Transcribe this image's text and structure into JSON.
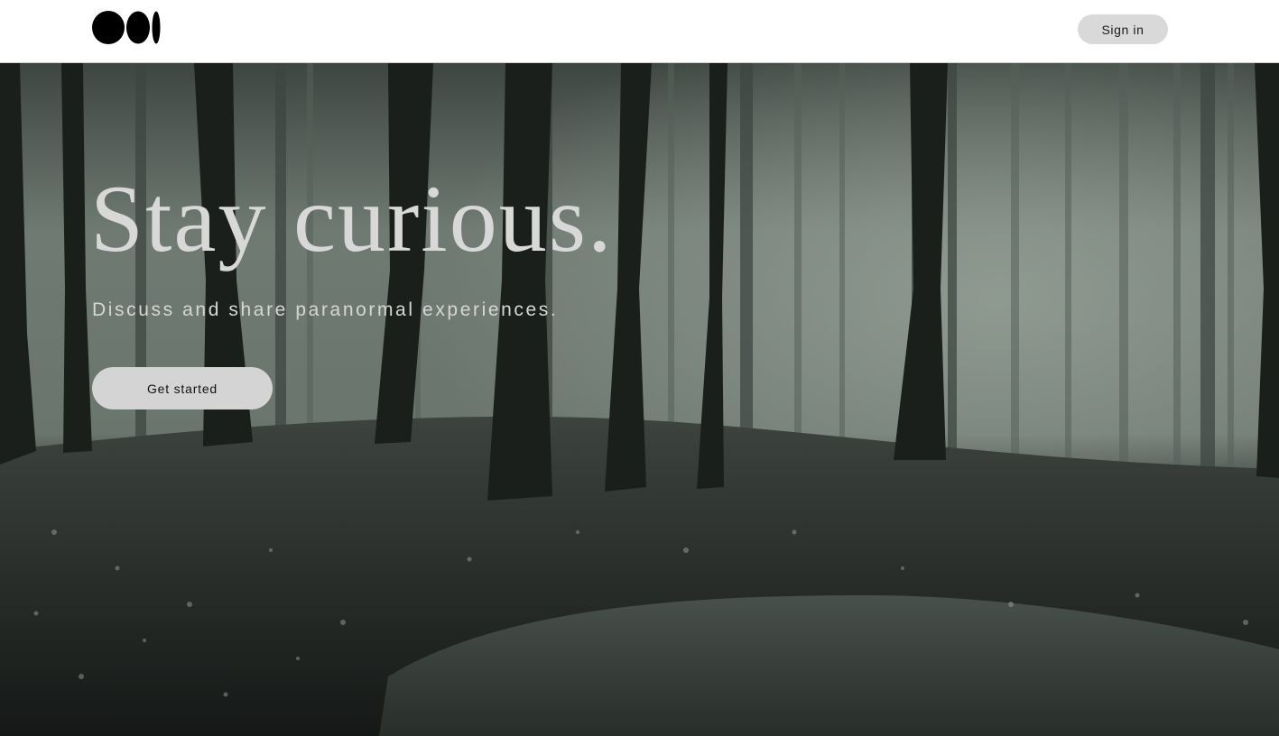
{
  "header": {
    "logo_icon": "medium-logo-icon",
    "signin_label": "Sign in"
  },
  "hero": {
    "headline": "Stay curious.",
    "subheadline": "Discuss and share paranormal experiences.",
    "cta_label": "Get started",
    "background": "misty-forest-image"
  },
  "colors": {
    "header_bg": "#ffffff",
    "button_bg": "#d9d9d9",
    "text_light": "#d8d8d8",
    "fog": "#7d877f"
  }
}
